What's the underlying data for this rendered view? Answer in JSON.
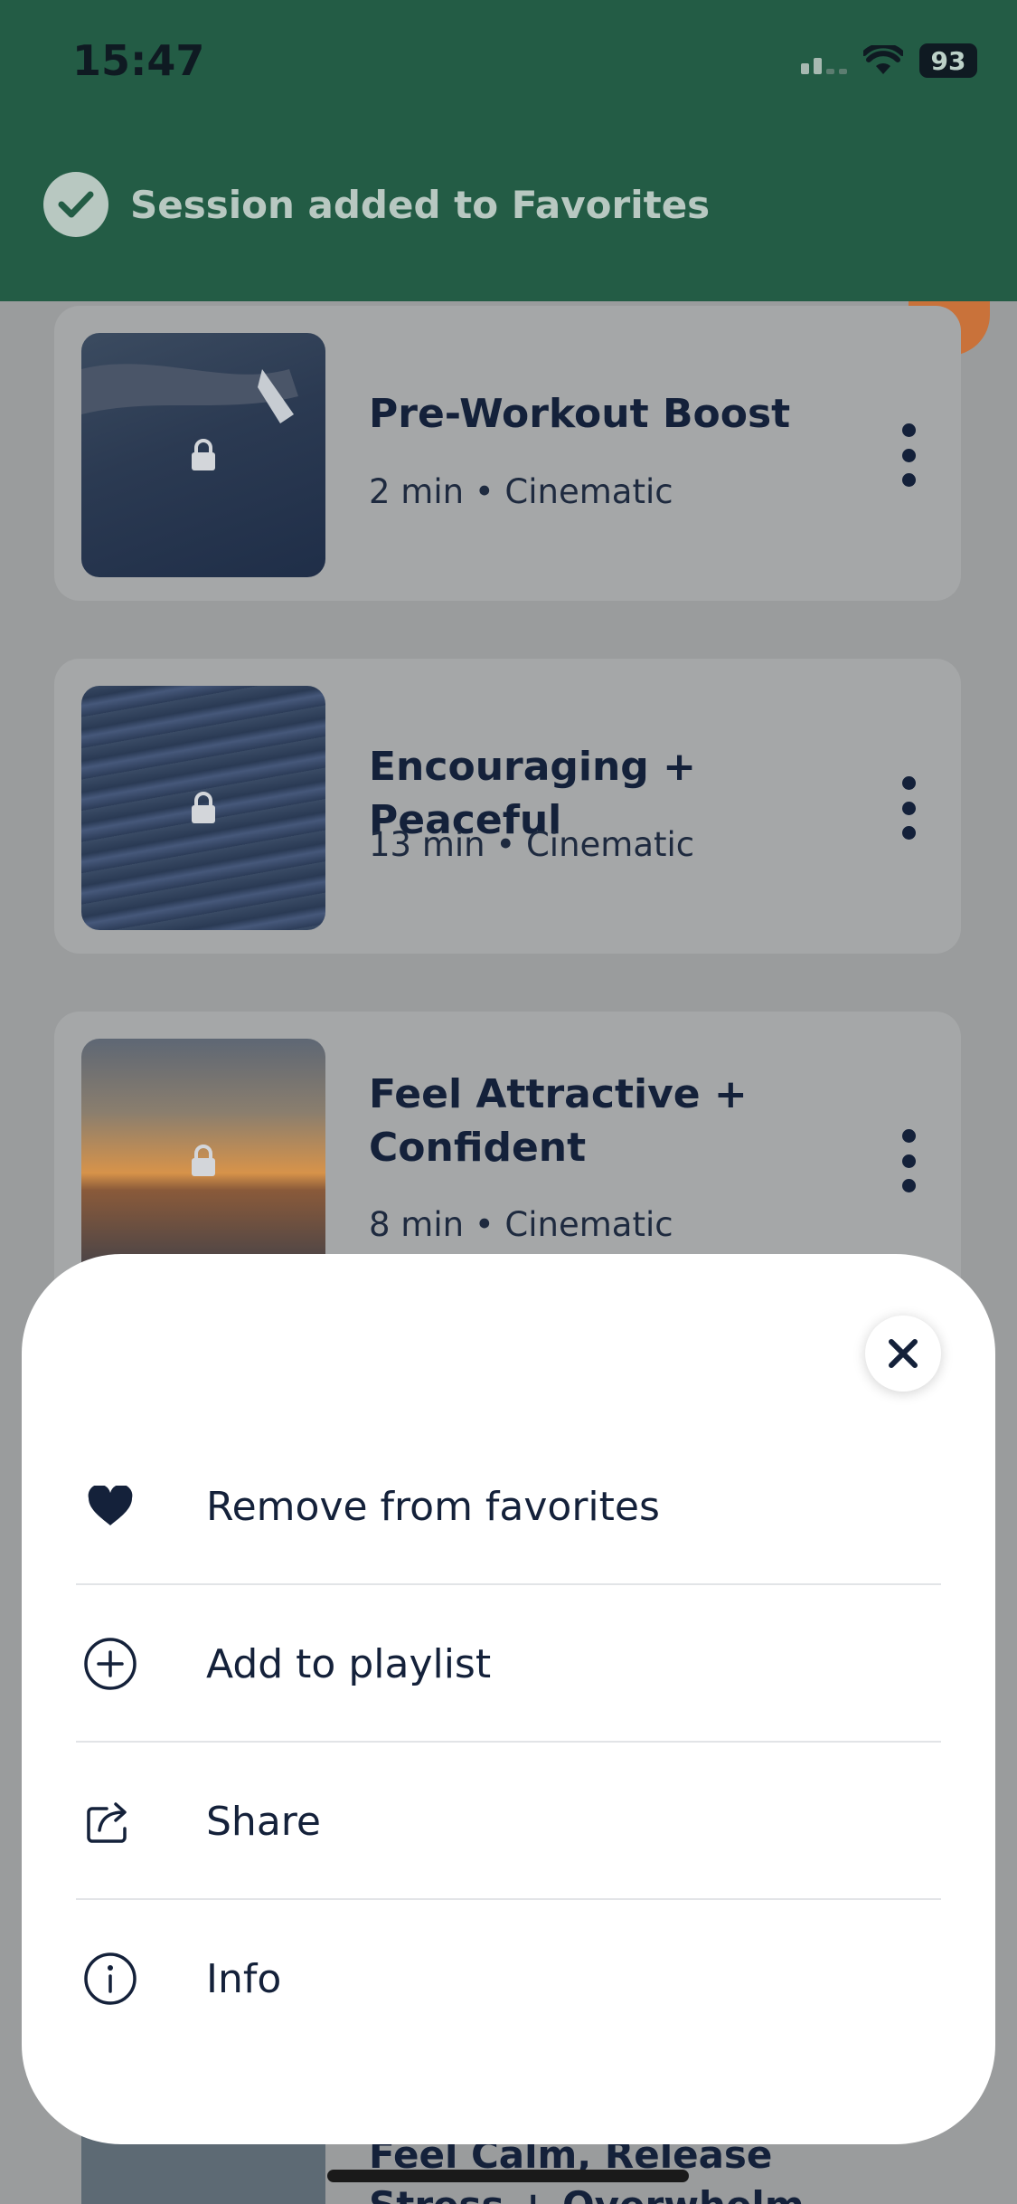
{
  "status_bar": {
    "time": "15:47",
    "battery": "93"
  },
  "toast": {
    "message": "Session added to Favorites",
    "icon": "check-circle-icon"
  },
  "sessions": [
    {
      "title": "Pre-Workout Boost",
      "meta": "2 min • Cinematic",
      "locked": true
    },
    {
      "title": "Encouraging + Peaceful",
      "meta": "13 min • Cinematic",
      "locked": true
    },
    {
      "title": "Feel Attractive + Confident",
      "meta": "8 min • Cinematic",
      "locked": true
    },
    {
      "title": "Feel Calm, Release Stress + Overwhelm",
      "locked": true
    }
  ],
  "sheet": {
    "close_icon": "close-icon",
    "items": [
      {
        "label": "Remove from favorites",
        "icon": "heart-icon"
      },
      {
        "label": "Add to playlist",
        "icon": "plus-circle-icon"
      },
      {
        "label": "Share",
        "icon": "share-icon"
      },
      {
        "label": "Info",
        "icon": "info-icon"
      }
    ]
  },
  "colors": {
    "toast_bg": "#235c45",
    "text_primary": "#14213a",
    "sheet_bg": "#ffffff"
  }
}
